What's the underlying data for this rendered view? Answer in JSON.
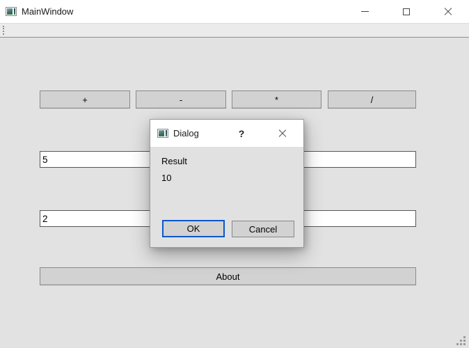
{
  "window": {
    "title": "MainWindow",
    "app_icon": "qt-window-icon",
    "controls": {
      "minimize_icon": "minimize",
      "maximize_icon": "maximize",
      "close_icon": "close"
    }
  },
  "toolbar": {
    "handle_icon": "toolbar-drag-handle"
  },
  "calculator": {
    "operator_buttons": [
      {
        "label": "+"
      },
      {
        "label": "-"
      },
      {
        "label": "*"
      },
      {
        "label": "/"
      }
    ],
    "operand_inputs": [
      {
        "value": "5"
      },
      {
        "value": "2"
      }
    ],
    "about_button_label": "About"
  },
  "dialog": {
    "title": "Dialog",
    "icon": "qt-window-icon",
    "help_button_label": "?",
    "close_icon": "close",
    "result_label": "Result",
    "result_value": "10",
    "ok_button_label": "OK",
    "cancel_button_label": "Cancel"
  },
  "status_bar": {
    "size_grip_icon": "resize-grip"
  },
  "colors": {
    "accent_blue": "#0b57c9",
    "button_face": "#d2d2d2",
    "window_background": "#e2e2e2",
    "titlebar_background": "#ffffff"
  }
}
